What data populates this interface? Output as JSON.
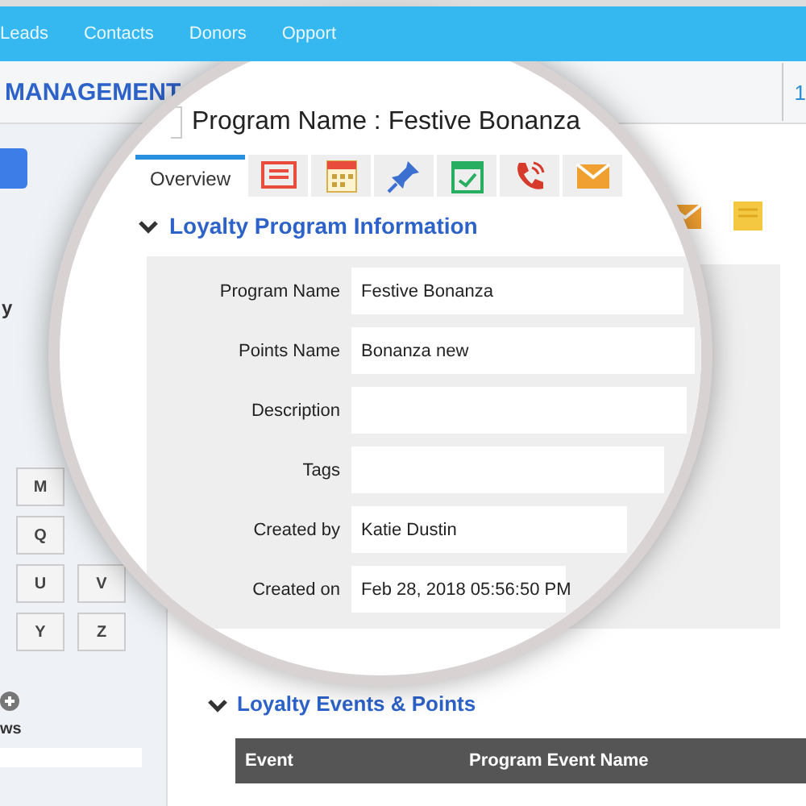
{
  "nav": {
    "items": [
      "Leads",
      "Contacts",
      "Donors",
      "Opport"
    ]
  },
  "header": {
    "title": "MANAGEMENT",
    "badge": "1"
  },
  "sidebar": {
    "label": "y",
    "letter_rows": [
      [
        "M"
      ],
      [
        "Q"
      ],
      [
        "U",
        "V"
      ],
      [
        "Y",
        "Z"
      ]
    ],
    "footer_label": "ws"
  },
  "background": {
    "section_title": "Loyalty Events & Points",
    "expanded": true,
    "table": {
      "columns": [
        "Event",
        "Program Event Name"
      ]
    }
  },
  "lens": {
    "title": "Program Name : Festive Bonanza",
    "tabs": [
      {
        "kind": "text",
        "label": "Overview",
        "selected": true
      },
      {
        "kind": "icon",
        "selected": false
      },
      {
        "kind": "icon",
        "selected": false
      },
      {
        "kind": "icon",
        "selected": false
      },
      {
        "kind": "icon",
        "selected": false
      },
      {
        "kind": "icon",
        "selected": false
      },
      {
        "kind": "icon",
        "selected": false
      }
    ],
    "section_title": "Loyalty Program Information",
    "expanded": true,
    "fields": [
      {
        "label": "Program Name",
        "value": "Festive Bonanza"
      },
      {
        "label": "Points Name",
        "value": "Bonanza new"
      },
      {
        "label": "Description"
      },
      {
        "label": "Tags"
      },
      {
        "label": "Created by",
        "value": "Katie Dustin"
      },
      {
        "label": "Created on",
        "value": "Feb 28, 2018 05:56:50 PM"
      }
    ]
  }
}
